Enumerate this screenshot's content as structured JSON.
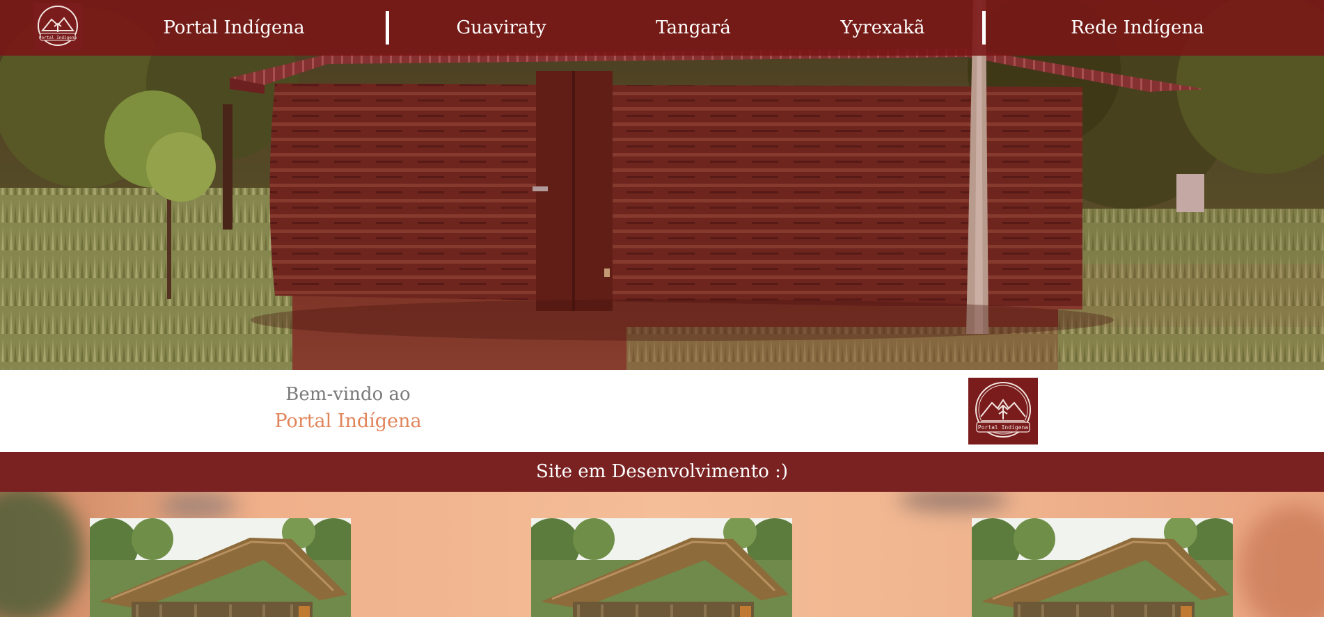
{
  "nav": {
    "logo_text": "Portal Indígena",
    "links": [
      {
        "label": "Portal Indígena"
      },
      {
        "label": "Guaviraty"
      },
      {
        "label": "Tangará"
      },
      {
        "label": "Yyrexakã"
      },
      {
        "label": "Rede Indígena"
      }
    ]
  },
  "welcome": {
    "line1": "Bem-vindo ao",
    "line2": "Portal Indígena",
    "logo_text": "Portal Indígena"
  },
  "banner": {
    "text": "Site em Desenvolvimento :)"
  },
  "cards": [
    {
      "icon": "thatched-hut-image"
    },
    {
      "icon": "thatched-hut-image"
    },
    {
      "icon": "thatched-hut-image"
    }
  ],
  "colors": {
    "nav_bg": "#7a1616",
    "banner_bg": "#7a2222",
    "accent_text": "#e0845a",
    "muted_text": "#7a7a7a"
  }
}
